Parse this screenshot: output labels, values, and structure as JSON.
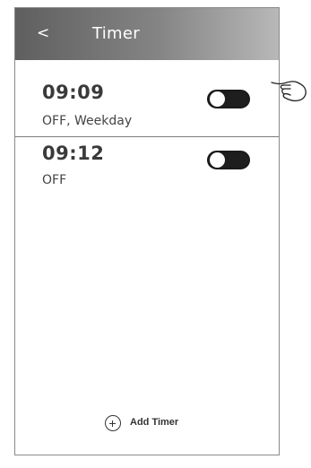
{
  "header": {
    "back_label": "<",
    "title": "Timer"
  },
  "timers": [
    {
      "time": "09:09",
      "detail": "OFF, Weekday",
      "enabled": false
    },
    {
      "time": "09:12",
      "detail": "OFF",
      "enabled": false
    }
  ],
  "footer": {
    "add_label": "Add Timer"
  },
  "icons": {
    "add": "plus-circle-icon",
    "pointer": "pointing-hand-icon"
  }
}
